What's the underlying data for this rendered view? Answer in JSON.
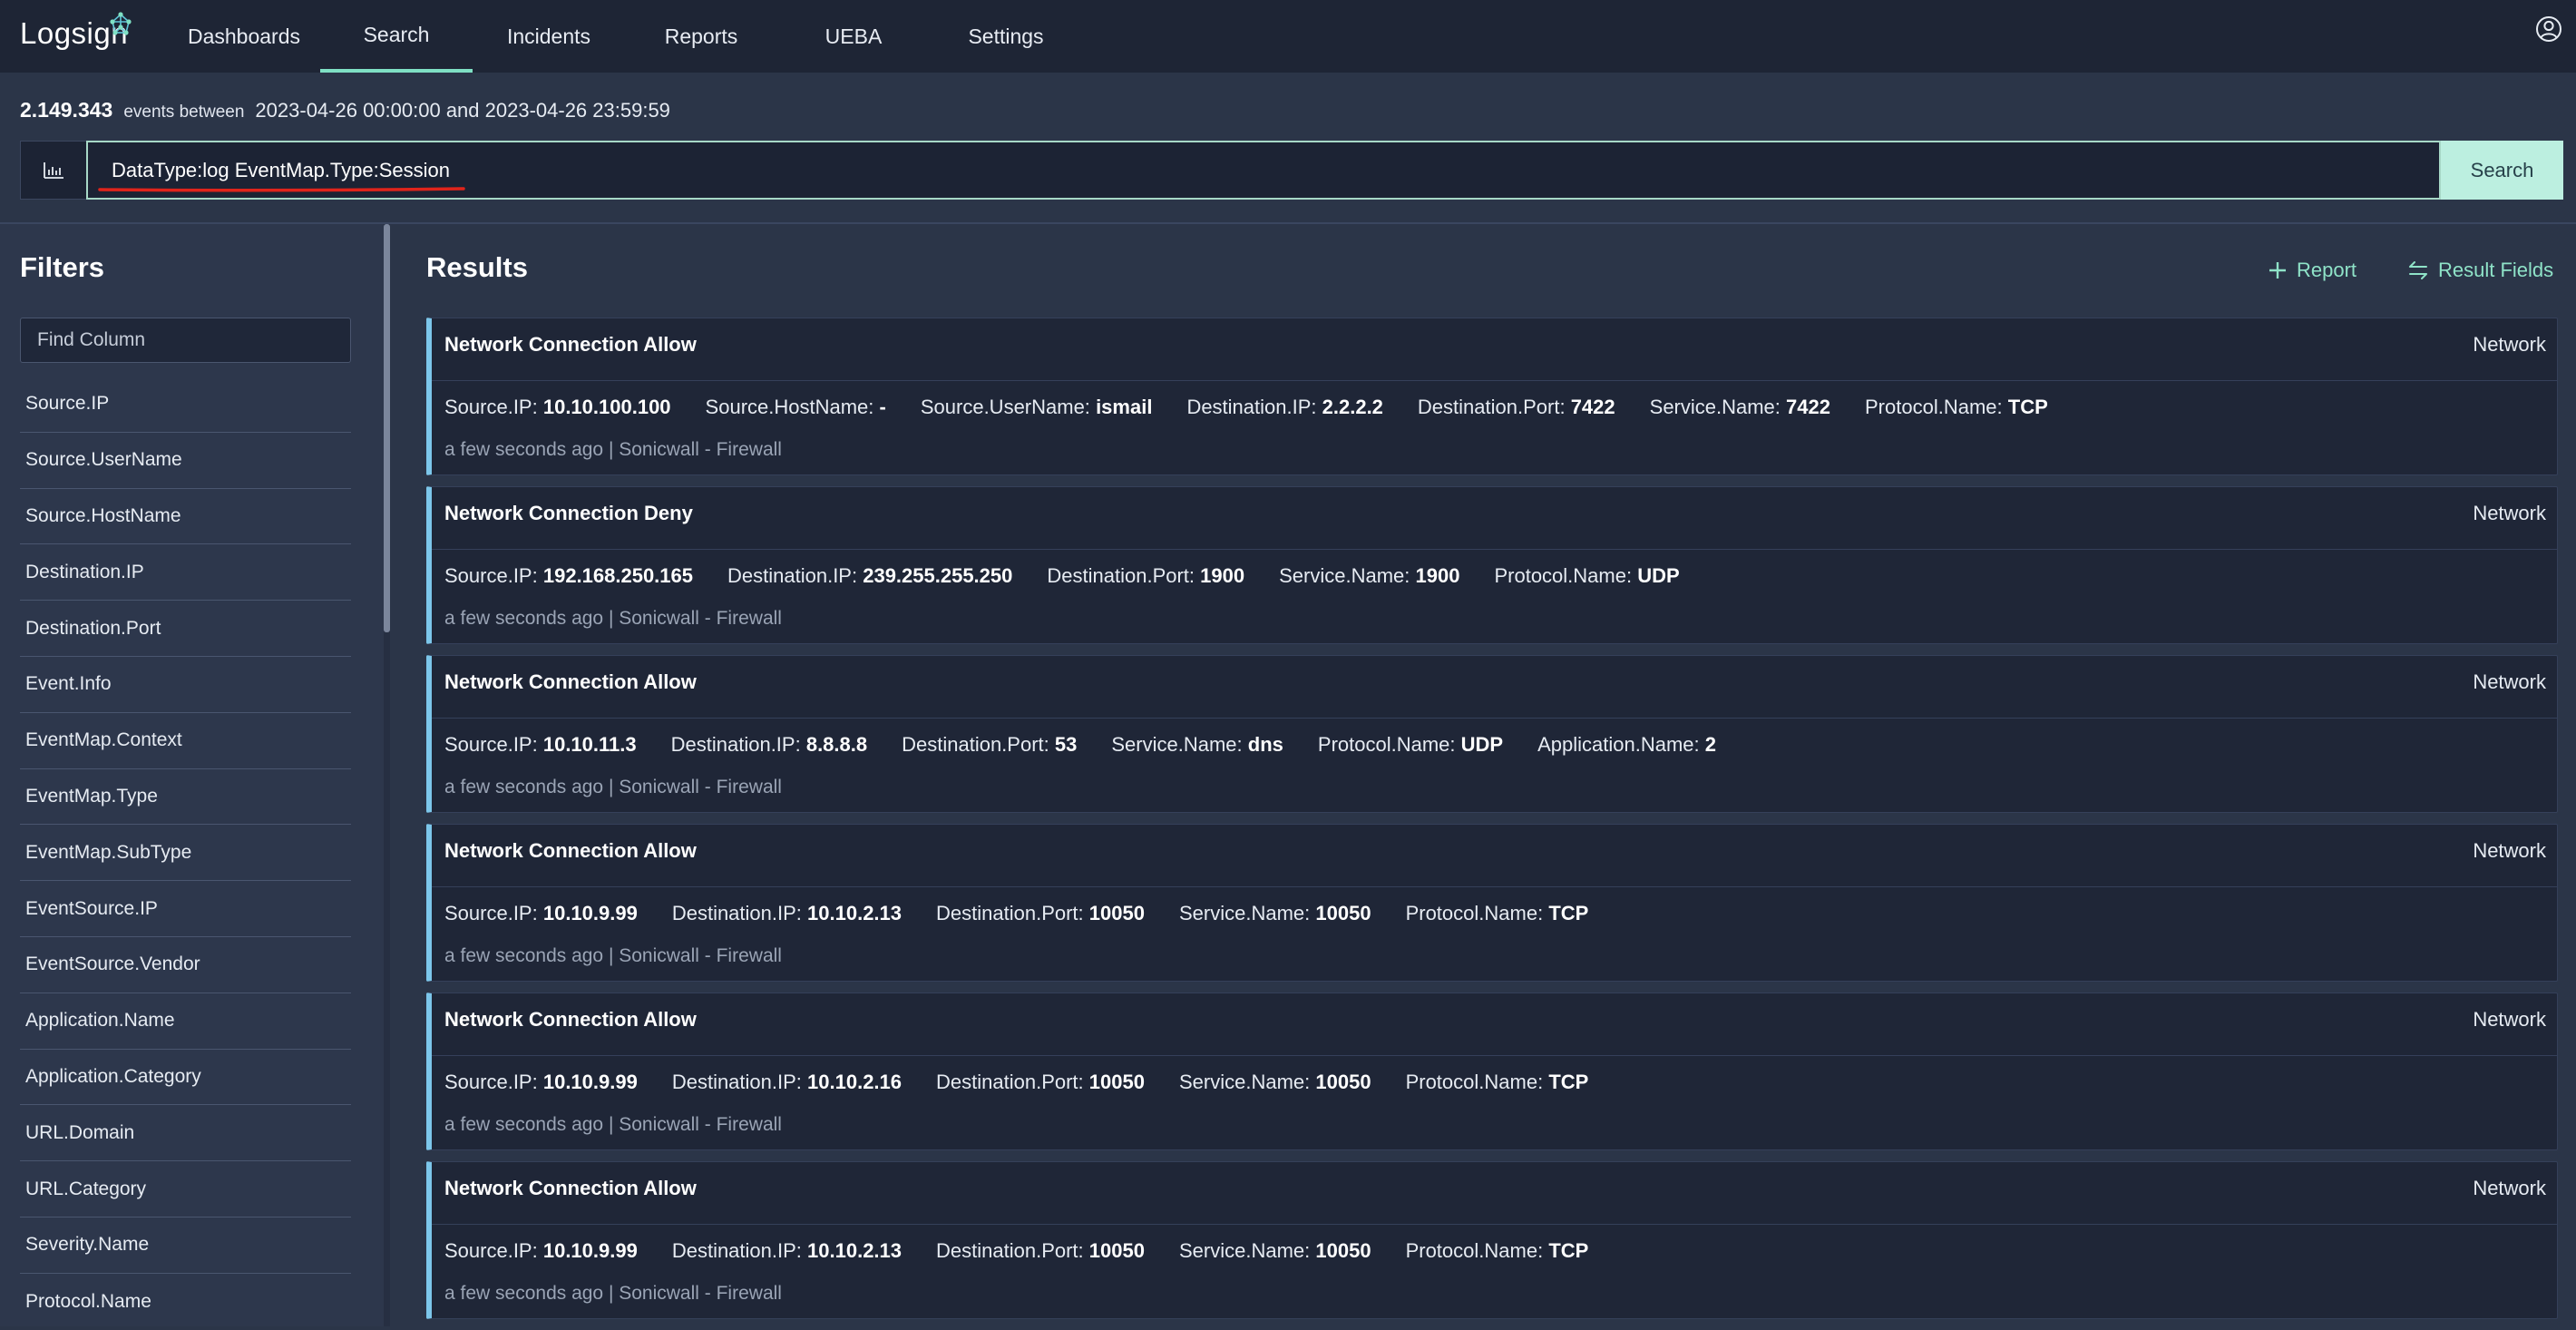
{
  "brand": {
    "name": "Logsign"
  },
  "nav": {
    "items": [
      {
        "label": "Dashboards",
        "active": false
      },
      {
        "label": "Search",
        "active": true
      },
      {
        "label": "Incidents",
        "active": false
      },
      {
        "label": "Reports",
        "active": false
      },
      {
        "label": "UEBA",
        "active": false
      },
      {
        "label": "Settings",
        "active": false
      }
    ]
  },
  "summary": {
    "count": "2.149.343",
    "between_label": "events between",
    "range": "2023-04-26 00:00:00 and 2023-04-26 23:59:59"
  },
  "search": {
    "query": "DataType:log EventMap.Type:Session",
    "button_label": "Search"
  },
  "filters": {
    "title": "Filters",
    "find_placeholder": "Find Column",
    "items": [
      "Source.IP",
      "Source.UserName",
      "Source.HostName",
      "Destination.IP",
      "Destination.Port",
      "Event.Info",
      "EventMap.Context",
      "EventMap.Type",
      "EventMap.SubType",
      "EventSource.IP",
      "EventSource.Vendor",
      "Application.Name",
      "Application.Category",
      "URL.Domain",
      "URL.Category",
      "Severity.Name",
      "Protocol.Name"
    ]
  },
  "results": {
    "title": "Results",
    "report_label": "Report",
    "fields_label": "Result Fields",
    "cards": [
      {
        "title": "Network Connection Allow",
        "category": "Network",
        "fields": [
          {
            "key": "Source.IP:",
            "value": "10.10.100.100"
          },
          {
            "key": "Source.HostName:",
            "value": "-"
          },
          {
            "key": "Source.UserName:",
            "value": "ismail"
          },
          {
            "key": "Destination.IP:",
            "value": "2.2.2.2"
          },
          {
            "key": "Destination.Port:",
            "value": "7422"
          },
          {
            "key": "Service.Name:",
            "value": "7422"
          },
          {
            "key": "Protocol.Name:",
            "value": "TCP"
          }
        ],
        "meta": "a few seconds ago | Sonicwall - Firewall"
      },
      {
        "title": "Network Connection Deny",
        "category": "Network",
        "fields": [
          {
            "key": "Source.IP:",
            "value": "192.168.250.165"
          },
          {
            "key": "Destination.IP:",
            "value": "239.255.255.250"
          },
          {
            "key": "Destination.Port:",
            "value": "1900"
          },
          {
            "key": "Service.Name:",
            "value": "1900"
          },
          {
            "key": "Protocol.Name:",
            "value": "UDP"
          }
        ],
        "meta": "a few seconds ago | Sonicwall - Firewall"
      },
      {
        "title": "Network Connection Allow",
        "category": "Network",
        "fields": [
          {
            "key": "Source.IP:",
            "value": "10.10.11.3"
          },
          {
            "key": "Destination.IP:",
            "value": "8.8.8.8"
          },
          {
            "key": "Destination.Port:",
            "value": "53"
          },
          {
            "key": "Service.Name:",
            "value": "dns"
          },
          {
            "key": "Protocol.Name:",
            "value": "UDP"
          },
          {
            "key": "Application.Name:",
            "value": "2"
          }
        ],
        "meta": "a few seconds ago | Sonicwall - Firewall"
      },
      {
        "title": "Network Connection Allow",
        "category": "Network",
        "fields": [
          {
            "key": "Source.IP:",
            "value": "10.10.9.99"
          },
          {
            "key": "Destination.IP:",
            "value": "10.10.2.13"
          },
          {
            "key": "Destination.Port:",
            "value": "10050"
          },
          {
            "key": "Service.Name:",
            "value": "10050"
          },
          {
            "key": "Protocol.Name:",
            "value": "TCP"
          }
        ],
        "meta": "a few seconds ago | Sonicwall - Firewall"
      },
      {
        "title": "Network Connection Allow",
        "category": "Network",
        "fields": [
          {
            "key": "Source.IP:",
            "value": "10.10.9.99"
          },
          {
            "key": "Destination.IP:",
            "value": "10.10.2.16"
          },
          {
            "key": "Destination.Port:",
            "value": "10050"
          },
          {
            "key": "Service.Name:",
            "value": "10050"
          },
          {
            "key": "Protocol.Name:",
            "value": "TCP"
          }
        ],
        "meta": "a few seconds ago | Sonicwall - Firewall"
      },
      {
        "title": "Network Connection Allow",
        "category": "Network",
        "fields": [
          {
            "key": "Source.IP:",
            "value": "10.10.9.99"
          },
          {
            "key": "Destination.IP:",
            "value": "10.10.2.13"
          },
          {
            "key": "Destination.Port:",
            "value": "10050"
          },
          {
            "key": "Service.Name:",
            "value": "10050"
          },
          {
            "key": "Protocol.Name:",
            "value": "TCP"
          }
        ],
        "meta": "a few seconds ago | Sonicwall - Firewall"
      }
    ]
  },
  "colors": {
    "accent": "#7fe0c4",
    "card_border": "#7cc6ea",
    "query_underline": "#e0241b",
    "search_button": "#bcefe0"
  }
}
